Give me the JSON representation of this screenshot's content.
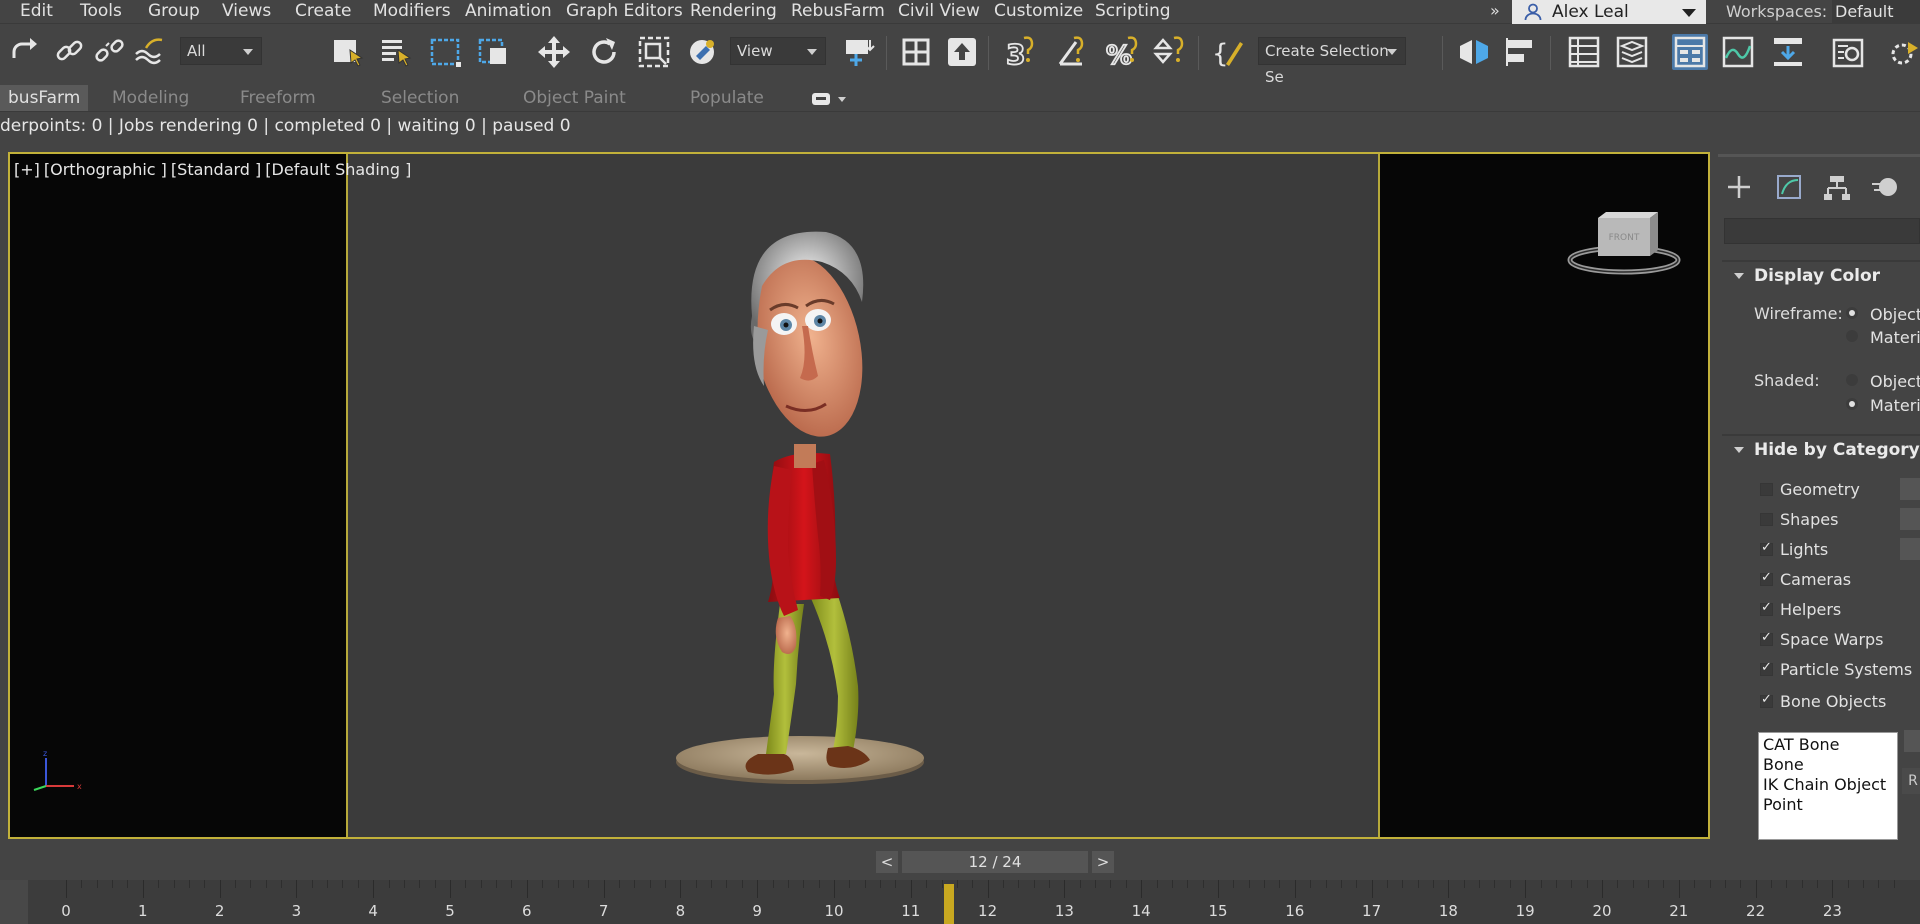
{
  "menu": {
    "items": [
      "Edit",
      "Tools",
      "Group",
      "Views",
      "Create",
      "Modifiers",
      "Animation",
      "Graph Editors",
      "Rendering",
      "RebusFarm",
      "Civil View",
      "Customize",
      "Scripting"
    ],
    "overflow": "»",
    "user": "Alex Leal",
    "workspaces_label": "Workspaces:",
    "workspaces_value": "Default"
  },
  "toolbar": {
    "selection_filter": "All",
    "reference_coord": "View",
    "named_selection": "Create Selection Se",
    "icons": [
      "redo-icon",
      "link-icon",
      "unlink-icon",
      "bind-spacewarp-icon",
      "select-object-icon",
      "select-by-name-icon",
      "rectangular-selection-icon",
      "window-crossing-icon",
      "select-move-icon",
      "select-rotate-icon",
      "select-scale-icon",
      "select-place-icon",
      "pivot-icon",
      "keyboard-shortcut-icon",
      "snaps-toggle-icon",
      "angle-snap-icon",
      "percent-snap-icon",
      "spinner-snap-icon",
      "edit-named-selection-icon",
      "mirror-icon",
      "align-icon",
      "scene-explorer-icon",
      "layer-explorer-icon",
      "toggle-ribbon-icon",
      "curve-editor-icon",
      "schematic-view-icon",
      "material-editor-icon",
      "render-setup-icon"
    ]
  },
  "ribbon": {
    "tabs": [
      "busFarm",
      "Modeling",
      "Freeform",
      "Selection",
      "Object Paint",
      "Populate"
    ],
    "active_tab": "busFarm"
  },
  "status": {
    "text": "derpoints: 0 | Jobs rendering 0 | completed 0 | waiting 0 | paused 0"
  },
  "viewport": {
    "label_plus": "[+]",
    "label_view": "[Orthographic ]",
    "label_standard": "[Standard ]",
    "label_shading": "[Default Shading ]"
  },
  "command_panel": {
    "display_color": {
      "title": "Display Color",
      "wireframe_label": "Wireframe:",
      "shaded_label": "Shaded:",
      "option_object": "Object",
      "option_material": "Materi",
      "wireframe_selected": "Object",
      "shaded_selected": "Material"
    },
    "hide_by_category": {
      "title": "Hide by Category",
      "items": [
        {
          "label": "Geometry",
          "checked": false
        },
        {
          "label": "Shapes",
          "checked": false
        },
        {
          "label": "Lights",
          "checked": true
        },
        {
          "label": "Cameras",
          "checked": true
        },
        {
          "label": "Helpers",
          "checked": true
        },
        {
          "label": "Space Warps",
          "checked": true
        },
        {
          "label": "Particle Systems",
          "checked": true
        },
        {
          "label": "Bone Objects",
          "checked": true
        }
      ],
      "list": [
        "CAT Bone",
        "Bone",
        "IK Chain Object",
        "Point"
      ],
      "list_button": "R"
    }
  },
  "frame_slider": {
    "prev": "<",
    "next": ">",
    "position": "12 / 24",
    "current_frame": 12,
    "total_frames": 24
  },
  "timeline": {
    "labels": [
      "0",
      "1",
      "2",
      "3",
      "4",
      "5",
      "6",
      "7",
      "8",
      "9",
      "10",
      "11",
      "12",
      "13",
      "14",
      "15",
      "16",
      "17",
      "18",
      "19",
      "20",
      "21",
      "22",
      "23"
    ]
  },
  "colors": {
    "ui_background": "#444444",
    "viewport_background": "#3b3b3b",
    "viewport_border": "#c2b13a",
    "active_icon": "#4c79a8",
    "time_marker": "#c8a820"
  }
}
